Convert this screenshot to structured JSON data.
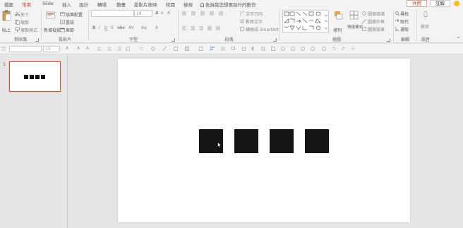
{
  "tabs": [
    {
      "label": "檔案",
      "active": false
    },
    {
      "label": "常用",
      "active": true
    },
    {
      "label": "Slide",
      "active": false
    },
    {
      "label": "插入",
      "active": false
    },
    {
      "label": "設計",
      "active": false
    },
    {
      "label": "轉場",
      "active": false
    },
    {
      "label": "動畫",
      "active": false
    },
    {
      "label": "投影片放映",
      "active": false
    },
    {
      "label": "校閱",
      "active": false
    },
    {
      "label": "檢視",
      "active": false
    }
  ],
  "tell_me": "告訴我您想要執行的動作",
  "share_label": "共用",
  "comments_label": "註解",
  "accent_color": "#c43e1c",
  "ribbon": {
    "clipboard": {
      "label": "剪貼簿",
      "paste": "貼上",
      "cut": "剪下",
      "copy": "複製",
      "format_painter": "複製格式"
    },
    "slides": {
      "label": "投影片",
      "new_slide": "新增投影片",
      "layout": "版面配置",
      "reset": "重設",
      "section": "章節"
    },
    "font": {
      "label": "字型",
      "font_name": "",
      "font_size": "18"
    },
    "paragraph": {
      "label": "段落",
      "text_direction": "文字方向",
      "align_text": "對齊文字",
      "smartart": "轉換成 SmartArt"
    },
    "drawing": {
      "label": "繪圖",
      "arrange": "排列",
      "quick_styles": "快速樣式",
      "shape_fill": "圖案填滿",
      "shape_outline": "圖案外框",
      "shape_effects": "圖案效果"
    },
    "editing": {
      "label": "編輯",
      "find": "尋找",
      "replace": "取代",
      "select": "選取"
    },
    "voice": {
      "label": "語音",
      "dictate": "聽寫"
    }
  },
  "quick_toolbar": {
    "font_size": "18"
  },
  "thumbnails": [
    {
      "number": "1",
      "selected": true
    }
  ],
  "slide": {
    "square_count": 4,
    "square_color": "#161616"
  }
}
